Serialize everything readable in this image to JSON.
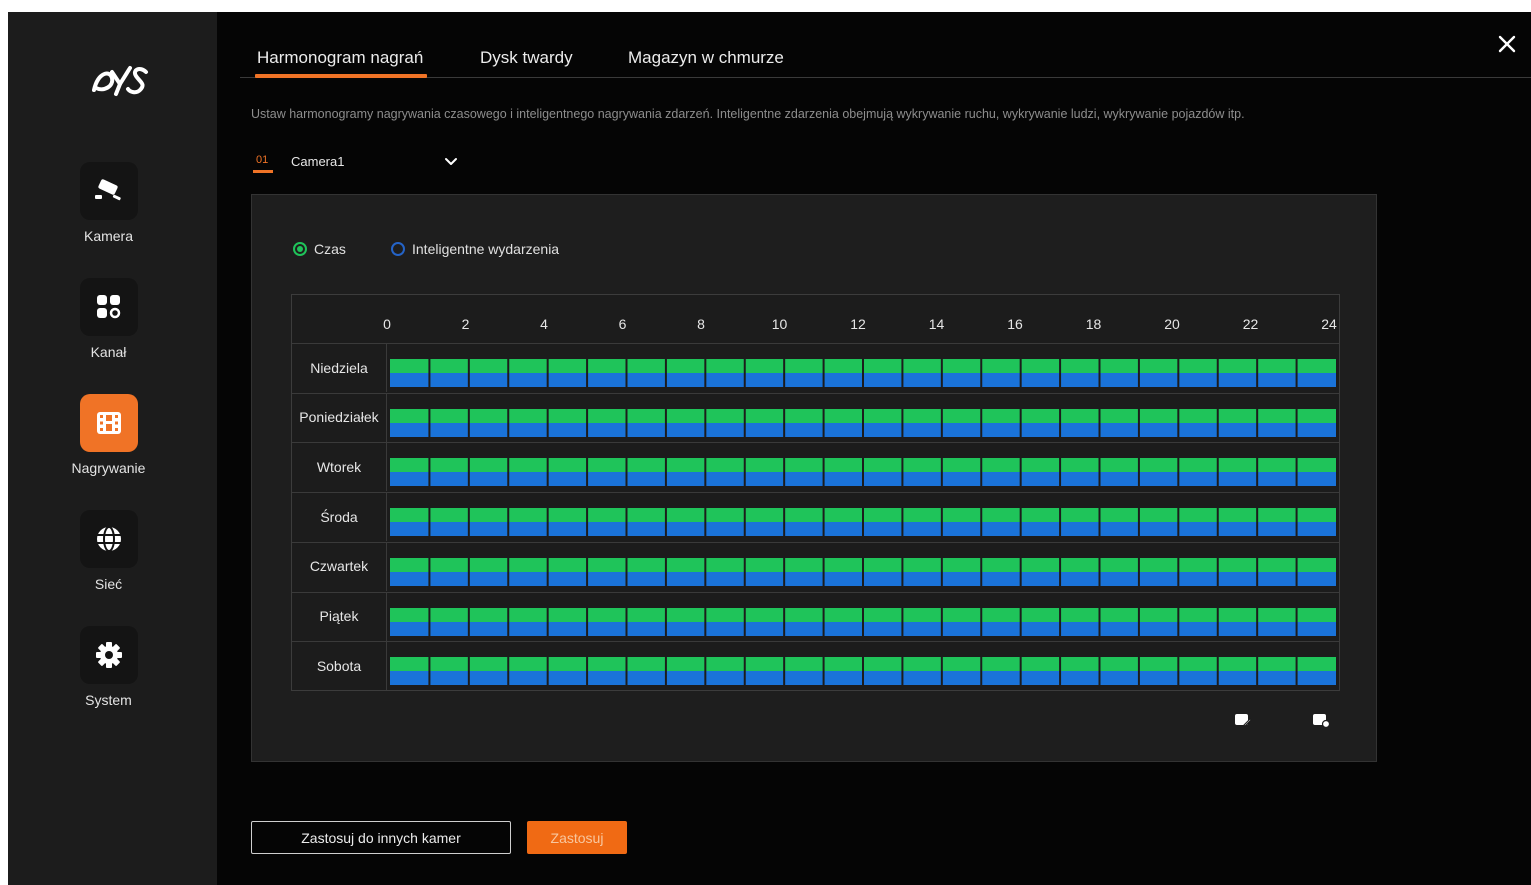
{
  "app": {
    "logo_text": "DYS"
  },
  "sidebar": {
    "items": [
      {
        "label": "Kamera",
        "icon": "camera-icon",
        "active": false
      },
      {
        "label": "Kanał",
        "icon": "channel-grid-icon",
        "active": false
      },
      {
        "label": "Nagrywanie",
        "icon": "film-icon",
        "active": true
      },
      {
        "label": "Sieć",
        "icon": "globe-icon",
        "active": false
      },
      {
        "label": "System",
        "icon": "gear-icon",
        "active": false
      }
    ]
  },
  "tabs": [
    {
      "label": "Harmonogram nagrań",
      "active": true
    },
    {
      "label": "Dysk twardy",
      "active": false
    },
    {
      "label": "Magazyn w chmurze",
      "active": false
    }
  ],
  "description": "Ustaw harmonogramy nagrywania czasowego i inteligentnego nagrywania zdarzeń. Inteligentne zdarzenia obejmują wykrywanie ruchu, wykrywanie ludzi, wykrywanie pojazdów itp.",
  "camera": {
    "number": "01",
    "selected": "Camera1"
  },
  "legend": [
    {
      "label": "Czas",
      "color": "#1fc45a",
      "selected": true
    },
    {
      "label": "Inteligentne wydarzenia",
      "color": "#2463c7",
      "selected": false
    }
  ],
  "schedule": {
    "hour_labels": [
      "0",
      "2",
      "4",
      "6",
      "8",
      "10",
      "12",
      "14",
      "16",
      "18",
      "20",
      "22",
      "24"
    ],
    "days": [
      {
        "label": "Niedziela",
        "time_hours": [
          0,
          24
        ],
        "event_hours": [
          0,
          24
        ]
      },
      {
        "label": "Poniedziałek",
        "time_hours": [
          0,
          24
        ],
        "event_hours": [
          0,
          24
        ]
      },
      {
        "label": "Wtorek",
        "time_hours": [
          0,
          24
        ],
        "event_hours": [
          0,
          24
        ]
      },
      {
        "label": "Środa",
        "time_hours": [
          0,
          24
        ],
        "event_hours": [
          0,
          24
        ]
      },
      {
        "label": "Czwartek",
        "time_hours": [
          0,
          24
        ],
        "event_hours": [
          0,
          24
        ]
      },
      {
        "label": "Piątek",
        "time_hours": [
          0,
          24
        ],
        "event_hours": [
          0,
          24
        ]
      },
      {
        "label": "Sobota",
        "time_hours": [
          0,
          24
        ],
        "event_hours": [
          0,
          24
        ]
      }
    ],
    "time_color": "#1fc45a",
    "event_color": "#1a73d9"
  },
  "toolbar": {
    "edit_icon": "edit-schedule-icon",
    "copy_icon": "copy-schedule-icon"
  },
  "buttons": {
    "apply_to_others": "Zastosuj do innych kamer",
    "apply": "Zastosuj"
  },
  "colors": {
    "accent": "#f07326",
    "sidebar_bg": "#1c1c1c",
    "panel_bg": "#1e1e1e"
  }
}
